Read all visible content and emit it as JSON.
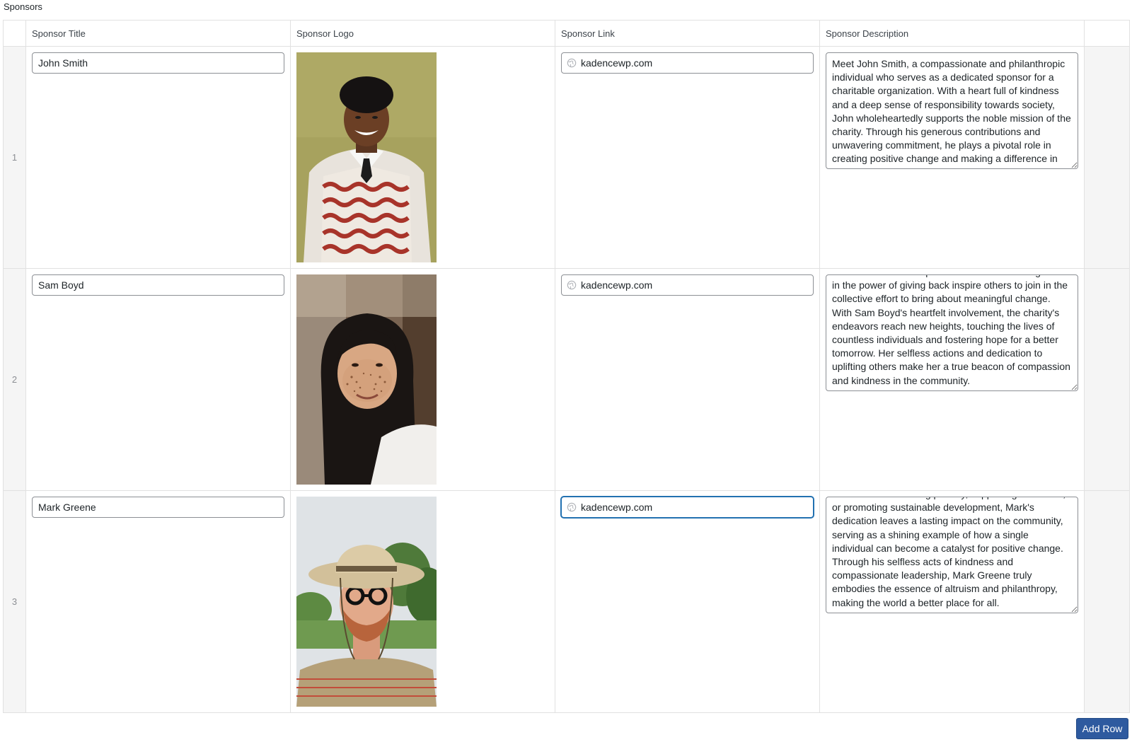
{
  "section": {
    "label": "Sponsors"
  },
  "columns": {
    "title": "Sponsor Title",
    "logo": "Sponsor Logo",
    "link": "Sponsor Link",
    "description": "Sponsor Description"
  },
  "rows": [
    {
      "order": "1",
      "title": "John Smith",
      "link": "kadencewp.com",
      "description": "Meet John Smith, a compassionate and philanthropic individual who serves as a dedicated sponsor for a charitable organization. With a heart full of kindness and a deep sense of responsibility towards society, John wholeheartedly supports the noble mission of the charity. Through his generous contributions and unwavering commitment, he plays a pivotal role in creating positive change and making a difference in"
    },
    {
      "order": "2",
      "title": "Sam Boyd",
      "link": "kadencewp.com",
      "description": "communities. Her empathetic nature and strong belief in the power of giving back inspire others to join in the collective effort to bring about meaningful change. With Sam Boyd's heartfelt involvement, the charity's endeavors reach new heights, touching the lives of countless individuals and fostering hope for a better tomorrow. Her selfless actions and dedication to uplifting others make her a true beacon of compassion and kindness in the community."
    },
    {
      "order": "3",
      "title": "Mark Greene",
      "link": "kadencewp.com",
      "description": "Whether it's alleviating poverty, supporting education, or promoting sustainable development, Mark's dedication leaves a lasting impact on the community, serving as a shining example of how a single individual can become a catalyst for positive change. Through his selfless acts of kindness and compassionate leadership, Mark Greene truly embodies the essence of altruism and philanthropy, making the world a better place for all."
    }
  ],
  "actions": {
    "add_row": "Add Row"
  }
}
